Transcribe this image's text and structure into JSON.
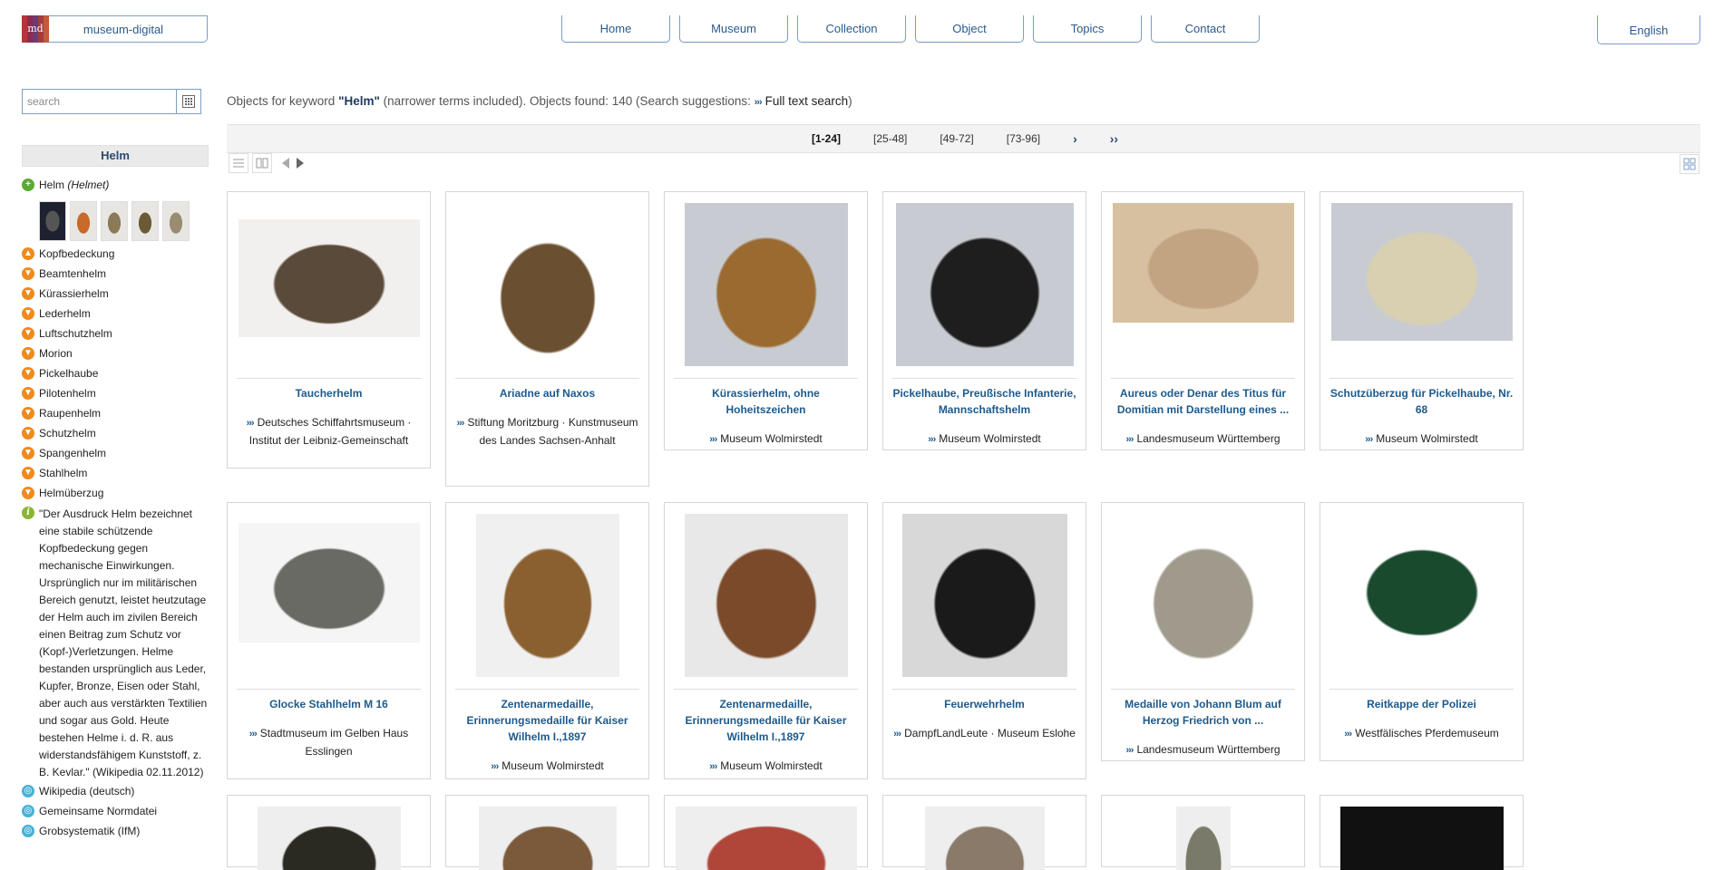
{
  "header": {
    "logo_mark": "md",
    "logo_text": "museum-digital",
    "nav": [
      "Home",
      "Museum",
      "Collection",
      "Object",
      "Topics",
      "Contact"
    ],
    "language": "English"
  },
  "sidebar": {
    "search_placeholder": "search",
    "heading": "Helm",
    "term": "Helm",
    "term_translation": "(Helmet)",
    "thumb_colors": [
      "#2b2d33",
      "#c76a2a",
      "#8a7a55",
      "#6b5a36",
      "#9a8c70"
    ],
    "broader": [
      "Kopfbedeckung"
    ],
    "narrower": [
      "Beamtenhelm",
      "Kürassierhelm",
      "Lederhelm",
      "Luftschutzhelm",
      "Morion",
      "Pickelhaube",
      "Pilotenhelm",
      "Raupenhelm",
      "Schutzhelm",
      "Spangenhelm",
      "Stahlhelm",
      "Helmüberzug"
    ],
    "description": "\"Der Ausdruck Helm bezeichnet eine stabile schützende Kopfbedeckung gegen mechanische Einwirkungen. Ursprünglich nur im militärischen Bereich genutzt, leistet heutzutage der Helm auch im zivilen Bereich einen Beitrag zum Schutz vor (Kopf-)Verletzungen. Helme bestanden ursprünglich aus Leder, Kupfer, Bronze, Eisen oder Stahl, aber auch aus verstärkten Textilien und sogar aus Gold. Heute bestehen Helme i. d. R. aus widerstandsfähigem Kunststoff, z. B. Kevlar.\" (Wikipedia 02.11.2012)",
    "links": [
      "Wikipedia (deutsch)",
      "Gemeinsame Normdatei",
      "Grobsystematik (IfM)"
    ]
  },
  "results": {
    "prefix": "Objects for keyword",
    "keyword": "\"Helm\"",
    "suffix": "(narrower terms included). Objects found: 140 (Search suggestions:",
    "fulltext": "Full text search",
    "close": ")",
    "pages": [
      "[1-24]",
      "[25-48]",
      "[49-72]",
      "[73-96]"
    ],
    "next": "›",
    "last": "››"
  },
  "objects": [
    {
      "title": "Taucherhelm",
      "institution": "Deutsches Schiffahrtsmuseum · Institut der Leibniz-Gemeinschaft",
      "img_color": "#5a4a3a",
      "img_bg": "#f2f0ee"
    },
    {
      "title": "Ariadne auf Naxos",
      "institution": "Stiftung Moritzburg · Kunstmuseum des Landes Sachsen-Anhalt",
      "img_color": "#6a5030",
      "img_bg": "#ffffff"
    },
    {
      "title": "Kürassierhelm, ohne Hoheitszeichen",
      "institution": "Museum Wolmirstedt",
      "img_color": "#9a6a30",
      "img_bg": "#c8ccd2"
    },
    {
      "title": "Pickelhaube, Preußische Infanterie, Mannschaftshelm",
      "institution": "Museum Wolmirstedt",
      "img_color": "#1e1e1e",
      "img_bg": "#c8ccd2"
    },
    {
      "title": "Aureus oder Denar des Titus für Domitian mit Darstellung eines ...",
      "institution": "Landesmuseum Württemberg",
      "img_color": "#c2a482",
      "img_bg": "#d7c0a0"
    },
    {
      "title": "Schutzüberzug für Pickelhaube, Nr. 68",
      "institution": "Museum Wolmirstedt",
      "img_color": "#d8d0b0",
      "img_bg": "#c8ccd2"
    },
    {
      "title": "Glocke Stahlhelm M 16",
      "institution": "Stadtmuseum im Gelben Haus Esslingen",
      "img_color": "#6a6a64",
      "img_bg": "#f5f5f5"
    },
    {
      "title": "Zentenarmedaille, Erinnerungsmedaille für Kaiser Wilhelm I.,1897",
      "institution": "Museum Wolmirstedt",
      "img_color": "#8a6030",
      "img_bg": "#f0f0f0"
    },
    {
      "title": "Zentenarmedaille, Erinnerungsmedaille für Kaiser Wilhelm I.,1897",
      "institution": "Museum Wolmirstedt",
      "img_color": "#7a4a2a",
      "img_bg": "#e8e8e8"
    },
    {
      "title": "Feuerwehrhelm",
      "institution": "DampfLandLeute · Museum Eslohe",
      "img_color": "#1a1a1a",
      "img_bg": "#d8d8d8"
    },
    {
      "title": "Medaille von Johann Blum auf Herzog Friedrich von ...",
      "institution": "Landesmuseum Württemberg",
      "img_color": "#a09a8c",
      "img_bg": "#ffffff"
    },
    {
      "title": "Reitkappe der Polizei",
      "institution": "Westfälisches Pferdemuseum",
      "img_color": "#1a4a2e",
      "img_bg": "#ffffff"
    }
  ],
  "partial_row_colors": [
    "#2a2a22",
    "#7a5a3a",
    "#b0463a",
    "#8a7a6a",
    "#7a7a6a",
    "#111111"
  ]
}
